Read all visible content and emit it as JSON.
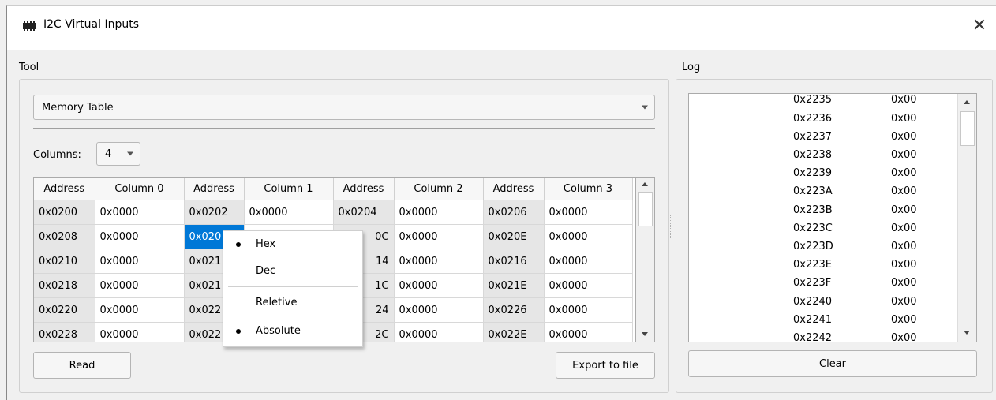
{
  "window": {
    "title": "I2C Virtual Inputs",
    "close_glyph": "✕"
  },
  "tool": {
    "label": "Tool",
    "mode_select": "Memory Table",
    "columns_label": "Columns:",
    "columns_value": "4",
    "headers": [
      "Address",
      "Column 0",
      "Address",
      "Column 1",
      "Address",
      "Column 2",
      "Address",
      "Column 3"
    ],
    "rows": [
      [
        "0x0200",
        "0x0000",
        "0x0202",
        "0x0000",
        "0x0204",
        "0x0000",
        "0x0206",
        "0x0000"
      ],
      [
        "0x0208",
        "0x0000",
        "0x020",
        "",
        "0C",
        "0x0000",
        "0x020E",
        "0x0000"
      ],
      [
        "0x0210",
        "0x0000",
        "0x021",
        "",
        "14",
        "0x0000",
        "0x0216",
        "0x0000"
      ],
      [
        "0x0218",
        "0x0000",
        "0x021",
        "",
        "1C",
        "0x0000",
        "0x021E",
        "0x0000"
      ],
      [
        "0x0220",
        "0x0000",
        "0x022",
        "",
        "24",
        "0x0000",
        "0x0226",
        "0x0000"
      ],
      [
        "0x0228",
        "0x0000",
        "0x022",
        "",
        "2C",
        "0x0000",
        "0x022E",
        "0x0000"
      ]
    ],
    "read_button": "Read",
    "export_button": "Export to file"
  },
  "context_menu": {
    "items": [
      {
        "label": "Hex",
        "checked": true
      },
      {
        "label": "Dec",
        "checked": false
      },
      {
        "label": "Reletive",
        "checked": false
      },
      {
        "label": "Absolute",
        "checked": true
      }
    ]
  },
  "log": {
    "label": "Log",
    "rows": [
      [
        "0x2235",
        "0x00"
      ],
      [
        "0x2236",
        "0x00"
      ],
      [
        "0x2237",
        "0x00"
      ],
      [
        "0x2238",
        "0x00"
      ],
      [
        "0x2239",
        "0x00"
      ],
      [
        "0x223A",
        "0x00"
      ],
      [
        "0x223B",
        "0x00"
      ],
      [
        "0x223C",
        "0x00"
      ],
      [
        "0x223D",
        "0x00"
      ],
      [
        "0x223E",
        "0x00"
      ],
      [
        "0x223F",
        "0x00"
      ],
      [
        "0x2240",
        "0x00"
      ],
      [
        "0x2241",
        "0x00"
      ],
      [
        "0x2242",
        "0x00"
      ]
    ],
    "clear_button": "Clear"
  },
  "colors": {
    "selection": "#0078d7",
    "address_bg": "#e6e6e6",
    "window_bg": "#f0f0f0"
  }
}
